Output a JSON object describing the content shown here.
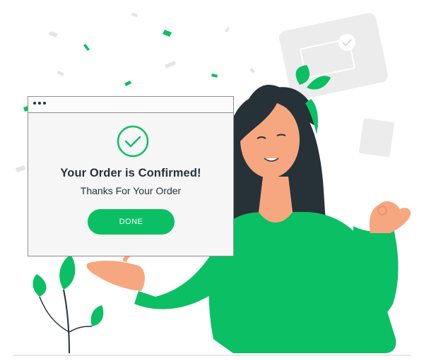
{
  "dialog": {
    "title": "Your Order is Confirmed!",
    "subtitle": "Thanks For Your Order",
    "done_label": "DONE"
  },
  "icons": {
    "dialog_icon": "check-circle-icon",
    "card_icon": "check-badge-icon"
  },
  "colors": {
    "accent": "#0bbf64",
    "dark": "#263238",
    "skin": "#f7a77f",
    "hair": "#263238",
    "panel_border": "#8f8f8f"
  }
}
